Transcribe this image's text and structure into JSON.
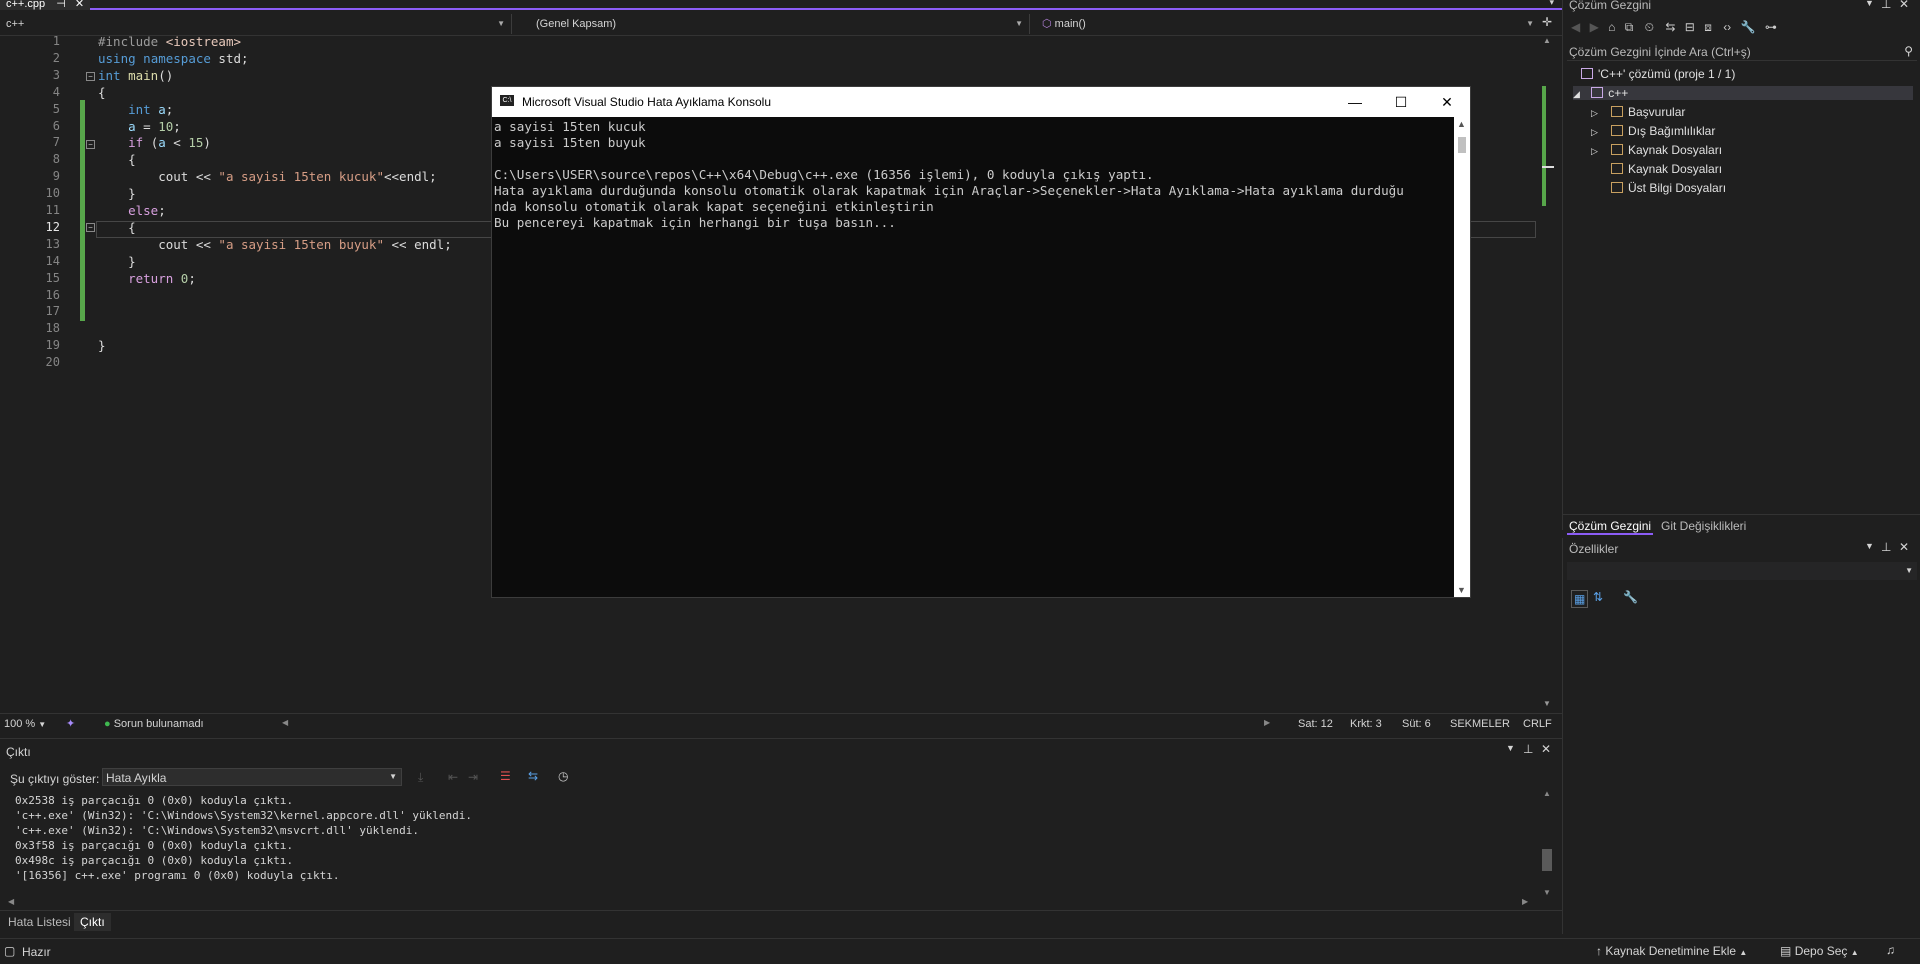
{
  "document_tab": {
    "label": "c++.cpp",
    "pin_icon": "pin-icon",
    "close_icon": "close-icon"
  },
  "navigation": {
    "project": "c++",
    "scope": "(Genel Kapsam)",
    "member": "main()"
  },
  "editor": {
    "line_numbers": [
      "1",
      "2",
      "3",
      "4",
      "5",
      "6",
      "7",
      "8",
      "9",
      "10",
      "11",
      "12",
      "13",
      "14",
      "15",
      "16",
      "17",
      "18",
      "19",
      "20"
    ],
    "current_line": 12,
    "code_lines": [
      {
        "t": "#include <iostream>"
      },
      {
        "t": "using namespace std;"
      },
      {
        "t": "int main()"
      },
      {
        "t": "{"
      },
      {
        "t": "    int a;"
      },
      {
        "t": "    a = 10;"
      },
      {
        "t": "    if (a < 15)"
      },
      {
        "t": "    {"
      },
      {
        "t": "        cout << \"a sayisi 15ten kucuk\"<<endl;"
      },
      {
        "t": "    }"
      },
      {
        "t": "    else;"
      },
      {
        "t": "    {"
      },
      {
        "t": "        cout << \"a sayisi 15ten buyuk\" << endl;"
      },
      {
        "t": "    }"
      },
      {
        "t": "    return 0;"
      },
      {
        "t": ""
      },
      {
        "t": ""
      },
      {
        "t": ""
      },
      {
        "t": "}"
      },
      {
        "t": ""
      }
    ]
  },
  "editor_status": {
    "zoom": "100 %",
    "issues": "Sorun bulunamadı",
    "line": "Sat: 12",
    "char": "Krkt: 3",
    "col": "Süt: 6",
    "indent": "SEKMELER",
    "eol": "CRLF"
  },
  "output": {
    "title": "Çıktı",
    "show_label": "Şu çıktıyı göster:",
    "source": "Hata Ayıkla",
    "lines": [
      "0x2538 iş parçacığı 0 (0x0) koduyla çıktı.",
      "'c++.exe' (Win32): 'C:\\Windows\\System32\\kernel.appcore.dll' yüklendi.",
      "'c++.exe' (Win32): 'C:\\Windows\\System32\\msvcrt.dll' yüklendi.",
      "0x3f58 iş parçacığı 0 (0x0) koduyla çıktı.",
      "0x498c iş parçacığı 0 (0x0) koduyla çıktı.",
      "'[16356] c++.exe' programı 0 (0x0) koduyla çıktı."
    ]
  },
  "bottom_tabs": {
    "errors": "Hata Listesi",
    "output": "Çıktı"
  },
  "status_bar": {
    "ready": "Hazır",
    "source_control": "Kaynak Denetimine Ekle",
    "repo": "Depo Seç"
  },
  "solution_explorer": {
    "title": "Çözüm Gezgini",
    "search_placeholder": "Çözüm Gezgini İçinde Ara (Ctrl+ş)",
    "solution": "'C++' çözümü (proje 1 / 1)",
    "project": "c++",
    "items": [
      "Başvurular",
      "Dış Bağımlılıklar",
      "Kaynak Dosyaları",
      "Kaynak Dosyaları",
      "Üst Bilgi Dosyaları"
    ],
    "tab_solution": "Çözüm Gezgini",
    "tab_git": "Git Değişiklikleri"
  },
  "properties": {
    "title": "Özellikler"
  },
  "console": {
    "title": "Microsoft Visual Studio Hata Ayıklama Konsolu",
    "lines": [
      "a sayisi 15ten kucuk",
      "a sayisi 15ten buyuk",
      "",
      "C:\\Users\\USER\\source\\repos\\C++\\x64\\Debug\\c++.exe (16356 işlemi), 0 koduyla çıkış yaptı.",
      "Hata ayıklama durduğunda konsolu otomatik olarak kapatmak için Araçlar->Seçenekler->Hata Ayıklama->Hata ayıklama durduğu",
      "nda konsolu otomatik olarak kapat seçeneğini etkinleştirin",
      "Bu pencereyi kapatmak için herhangi bir tuşa basın..."
    ]
  },
  "colors": {
    "accent": "#8b5cf6",
    "change_bar": "#57a64a",
    "background": "#1f1f1f",
    "console_bg": "#0c0c0c"
  }
}
